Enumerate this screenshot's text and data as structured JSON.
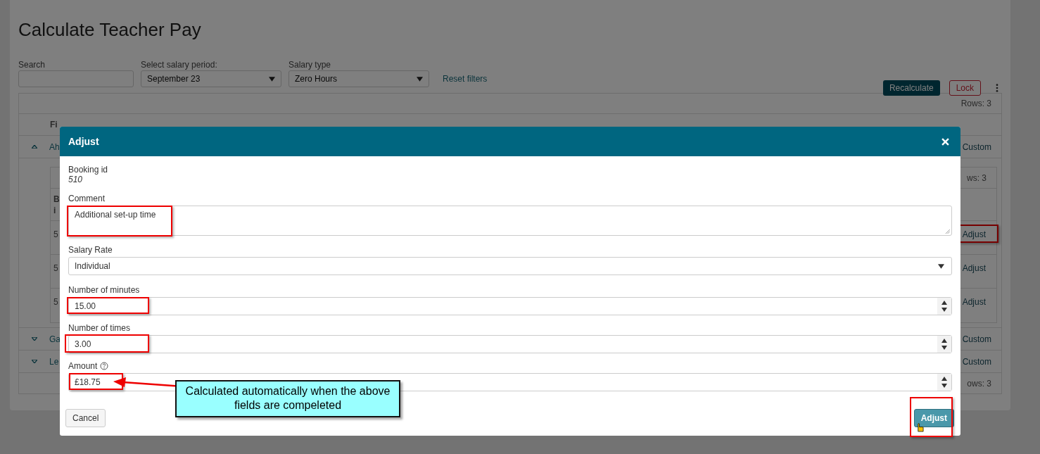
{
  "page": {
    "title": "Calculate Teacher Pay"
  },
  "filters": {
    "search": {
      "label": "Search"
    },
    "salary_period": {
      "label": "Select salary period:",
      "value": "September 23"
    },
    "salary_type": {
      "label": "Salary type",
      "value": "Zero Hours"
    },
    "reset": "Reset filters"
  },
  "actions": {
    "recalculate": "Recalculate",
    "lock": "Lock"
  },
  "table": {
    "rows_count": "Rows: 3",
    "column_1": "Fi",
    "footer_count": "ows: 3",
    "rows": [
      {
        "name": "Ah",
        "expanded": true,
        "last_column": "Custom",
        "nested": {
          "rows_count": "ws: 3",
          "header": "B i",
          "rows": [
            {
              "id": "5",
              "action": "Adjust",
              "highlighted": true
            },
            {
              "id": "5",
              "action": "Adjust",
              "highlighted": false
            },
            {
              "id": "5",
              "action": "Adjust",
              "highlighted": false
            }
          ]
        }
      },
      {
        "name": "Ga",
        "expanded": false,
        "last_column": "Custom"
      },
      {
        "name": "Le",
        "expanded": false,
        "last_column": "Custom"
      }
    ]
  },
  "modal": {
    "title": "Adjust",
    "booking_label": "Booking id",
    "booking_id": "510",
    "fields": [
      {
        "kind": "textarea",
        "label": "Comment",
        "value": "Additional set-up time",
        "highlighted": true
      },
      {
        "kind": "select",
        "label": "Salary Rate",
        "value": "Individual",
        "highlighted": false
      },
      {
        "kind": "number",
        "label": "Number of minutes",
        "value": "15.00",
        "highlighted": true
      },
      {
        "kind": "number",
        "label": "Number of times",
        "value": "3.00",
        "highlighted": true
      },
      {
        "kind": "number",
        "label": "Amount",
        "value": "£18.75",
        "help": true,
        "highlighted": true,
        "callout": "Calculated automatically when the above fields are compeleted"
      }
    ],
    "cancel": "Cancel",
    "submit": "Adjust",
    "submit_highlighted": true
  }
}
